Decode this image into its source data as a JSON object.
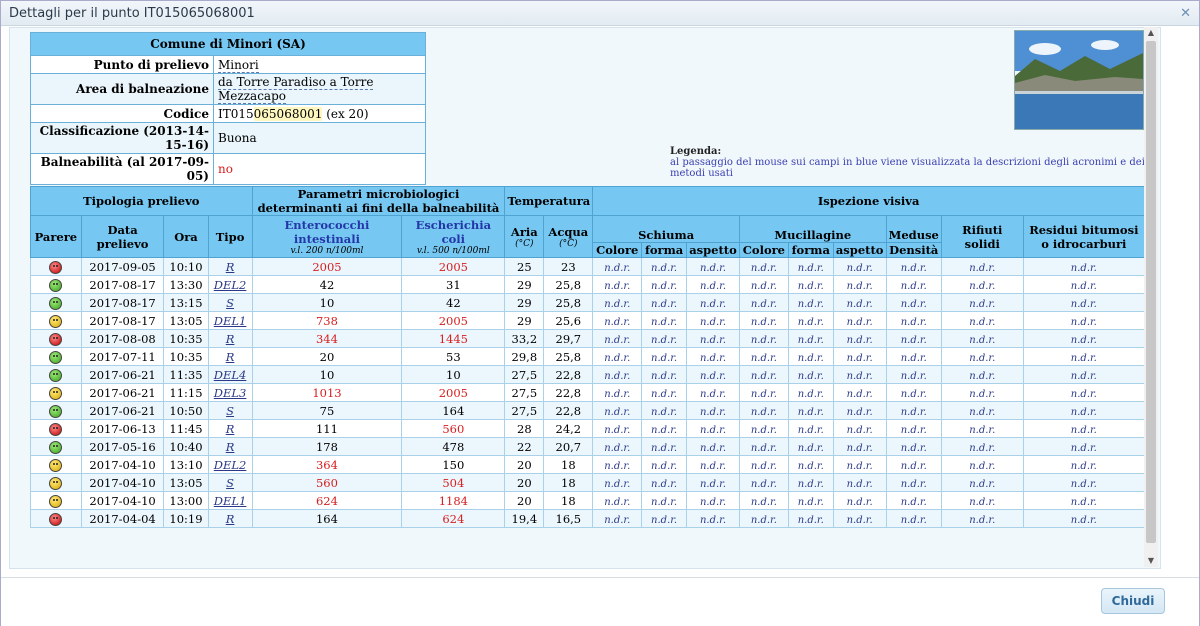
{
  "window": {
    "title": "Dettagli per il punto IT015065068001",
    "close_icon": "close-icon"
  },
  "info": {
    "header": "Comune di Minori (SA)",
    "rows": [
      {
        "label": "Punto di prelievo",
        "value": "Minori"
      },
      {
        "label": "Area di balneazione",
        "value": "da Torre Paradiso a Torre Mezzacapo"
      },
      {
        "label": "Codice",
        "value_prefix": "IT015",
        "value_hl": "065068001",
        "value_suffix": " (ex 20)"
      },
      {
        "label": "Classificazione (2013-14-15-16)",
        "value": "Buona"
      },
      {
        "label": "Balneabilità (al 2017-09-05)",
        "value": "no"
      }
    ]
  },
  "legend": {
    "title": "Legenda:",
    "text": "al passaggio del mouse sui campi in blue viene visualizzata la descrizioni degli acronimi e dei metodi usati"
  },
  "table": {
    "groups": {
      "tipologia": "Tipologia prelievo",
      "parametri": "Parametri microbiologici determinanti ai fini della balneabilità",
      "temperatura": "Temperatura",
      "ispezione": "Ispezione visiva"
    },
    "cols": {
      "parere": "Parere",
      "data": "Data prelievo",
      "ora": "Ora",
      "tipo": "Tipo",
      "entero": "Enterococchi intestinali",
      "entero_sub": "v.l. 200 n/100ml",
      "ecoli": "Escherichia coli",
      "ecoli_sub": "v.l. 500 n/100ml",
      "aria": "Aria",
      "aria_sub": "(°C)",
      "acqua": "Acqua",
      "acqua_sub": "(°C)",
      "schiuma": "Schiuma",
      "mucillagine": "Mucillagine",
      "meduse": "Meduse",
      "rifiuti": "Rifiuti solidi",
      "residui": "Residui bitumosi o idrocarburi",
      "colore": "Colore",
      "forma": "forma",
      "aspetto": "aspetto",
      "densita": "Densità"
    },
    "ndr": "n.d.r.",
    "rows": [
      {
        "parere": "red",
        "data": "2017-09-05",
        "ora": "10:10",
        "tipo": "R",
        "entero": "2005",
        "entero_bad": true,
        "ecoli": "2005",
        "ecoli_bad": true,
        "aria": "25",
        "acqua": "23"
      },
      {
        "parere": "green",
        "data": "2017-08-17",
        "ora": "13:30",
        "tipo": "DEL2",
        "entero": "42",
        "entero_bad": false,
        "ecoli": "31",
        "ecoli_bad": false,
        "aria": "29",
        "acqua": "25,8"
      },
      {
        "parere": "green",
        "data": "2017-08-17",
        "ora": "13:15",
        "tipo": "S",
        "entero": "10",
        "entero_bad": false,
        "ecoli": "42",
        "ecoli_bad": false,
        "aria": "29",
        "acqua": "25,8"
      },
      {
        "parere": "yellow",
        "data": "2017-08-17",
        "ora": "13:05",
        "tipo": "DEL1",
        "entero": "738",
        "entero_bad": true,
        "ecoli": "2005",
        "ecoli_bad": true,
        "aria": "29",
        "acqua": "25,6"
      },
      {
        "parere": "red",
        "data": "2017-08-08",
        "ora": "10:35",
        "tipo": "R",
        "entero": "344",
        "entero_bad": true,
        "ecoli": "1445",
        "ecoli_bad": true,
        "aria": "33,2",
        "acqua": "29,7"
      },
      {
        "parere": "green",
        "data": "2017-07-11",
        "ora": "10:35",
        "tipo": "R",
        "entero": "20",
        "entero_bad": false,
        "ecoli": "53",
        "ecoli_bad": false,
        "aria": "29,8",
        "acqua": "25,8"
      },
      {
        "parere": "green",
        "data": "2017-06-21",
        "ora": "11:35",
        "tipo": "DEL4",
        "entero": "10",
        "entero_bad": false,
        "ecoli": "10",
        "ecoli_bad": false,
        "aria": "27,5",
        "acqua": "22,8"
      },
      {
        "parere": "yellow",
        "data": "2017-06-21",
        "ora": "11:15",
        "tipo": "DEL3",
        "entero": "1013",
        "entero_bad": true,
        "ecoli": "2005",
        "ecoli_bad": true,
        "aria": "27,5",
        "acqua": "22,8"
      },
      {
        "parere": "green",
        "data": "2017-06-21",
        "ora": "10:50",
        "tipo": "S",
        "entero": "75",
        "entero_bad": false,
        "ecoli": "164",
        "ecoli_bad": false,
        "aria": "27,5",
        "acqua": "22,8"
      },
      {
        "parere": "red",
        "data": "2017-06-13",
        "ora": "11:45",
        "tipo": "R",
        "entero": "111",
        "entero_bad": false,
        "ecoli": "560",
        "ecoli_bad": true,
        "aria": "28",
        "acqua": "24,2"
      },
      {
        "parere": "green",
        "data": "2017-05-16",
        "ora": "10:40",
        "tipo": "R",
        "entero": "178",
        "entero_bad": false,
        "ecoli": "478",
        "ecoli_bad": false,
        "aria": "22",
        "acqua": "20,7"
      },
      {
        "parere": "yellow",
        "data": "2017-04-10",
        "ora": "13:10",
        "tipo": "DEL2",
        "entero": "364",
        "entero_bad": true,
        "ecoli": "150",
        "ecoli_bad": false,
        "aria": "20",
        "acqua": "18"
      },
      {
        "parere": "yellow",
        "data": "2017-04-10",
        "ora": "13:05",
        "tipo": "S",
        "entero": "560",
        "entero_bad": true,
        "ecoli": "504",
        "ecoli_bad": true,
        "aria": "20",
        "acqua": "18"
      },
      {
        "parere": "yellow",
        "data": "2017-04-10",
        "ora": "13:00",
        "tipo": "DEL1",
        "entero": "624",
        "entero_bad": true,
        "ecoli": "1184",
        "ecoli_bad": true,
        "aria": "20",
        "acqua": "18"
      },
      {
        "parere": "red",
        "data": "2017-04-04",
        "ora": "10:19",
        "tipo": "R",
        "entero": "164",
        "entero_bad": false,
        "ecoli": "624",
        "ecoli_bad": true,
        "aria": "19,4",
        "acqua": "16,5"
      }
    ]
  },
  "footer": {
    "close_button": "Chiudi"
  }
}
